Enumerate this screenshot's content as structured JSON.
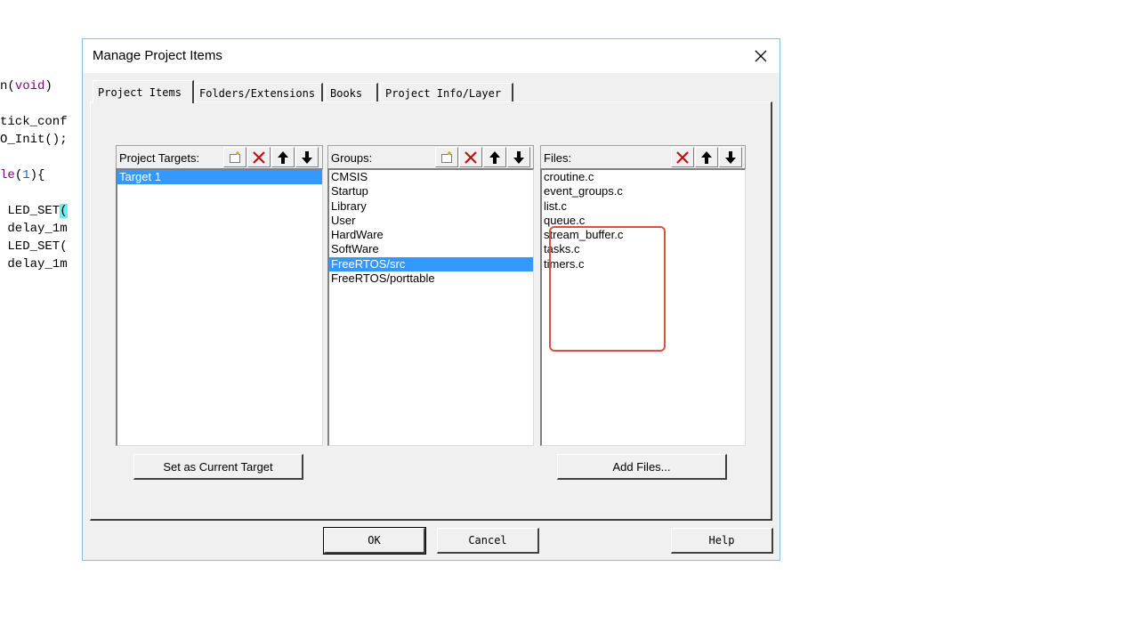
{
  "editor": {
    "lines": [
      {
        "parts": [
          {
            "t": "n",
            "c": ""
          },
          {
            "t": "(",
            "c": ""
          },
          {
            "t": "void",
            "c": "kw"
          },
          {
            "t": ")",
            "c": ""
          }
        ]
      },
      {
        "parts": [
          {
            "t": "tick_conf",
            "c": ""
          }
        ]
      },
      {
        "parts": [
          {
            "t": "O_Init();",
            "c": ""
          }
        ]
      },
      {
        "parts": [
          {
            "t": "le",
            "c": "kw"
          },
          {
            "t": "(",
            "c": ""
          },
          {
            "t": "1",
            "c": "num"
          },
          {
            "t": "){",
            "c": ""
          }
        ]
      },
      {
        "parts": [
          {
            "t": " LED_SET",
            "c": ""
          },
          {
            "t": "(",
            "c": "hl"
          }
        ]
      },
      {
        "parts": [
          {
            "t": " delay_1m",
            "c": ""
          }
        ]
      },
      {
        "parts": [
          {
            "t": " LED_SET(",
            "c": ""
          }
        ]
      },
      {
        "parts": [
          {
            "t": " delay_1m",
            "c": ""
          }
        ]
      }
    ]
  },
  "dialog": {
    "title": "Manage Project Items",
    "tabs": [
      "Project Items",
      "Folders/Extensions",
      "Books",
      "Project Info/Layer"
    ],
    "targets": {
      "label": "Project Targets:",
      "items": [
        "Target 1"
      ],
      "selected": 0,
      "button": "Set as Current Target"
    },
    "groups": {
      "label": "Groups:",
      "items": [
        "CMSIS",
        "Startup",
        "Library",
        "User",
        "HardWare",
        "SoftWare",
        "FreeRTOS/src",
        "FreeRTOS/porttable"
      ],
      "selected": 6
    },
    "files": {
      "label": "Files:",
      "items": [
        "croutine.c",
        "event_groups.c",
        "list.c",
        "queue.c",
        "stream_buffer.c",
        "tasks.c",
        "timers.c"
      ],
      "button": "Add Files..."
    },
    "buttons": {
      "ok": "OK",
      "cancel": "Cancel",
      "help": "Help"
    }
  }
}
